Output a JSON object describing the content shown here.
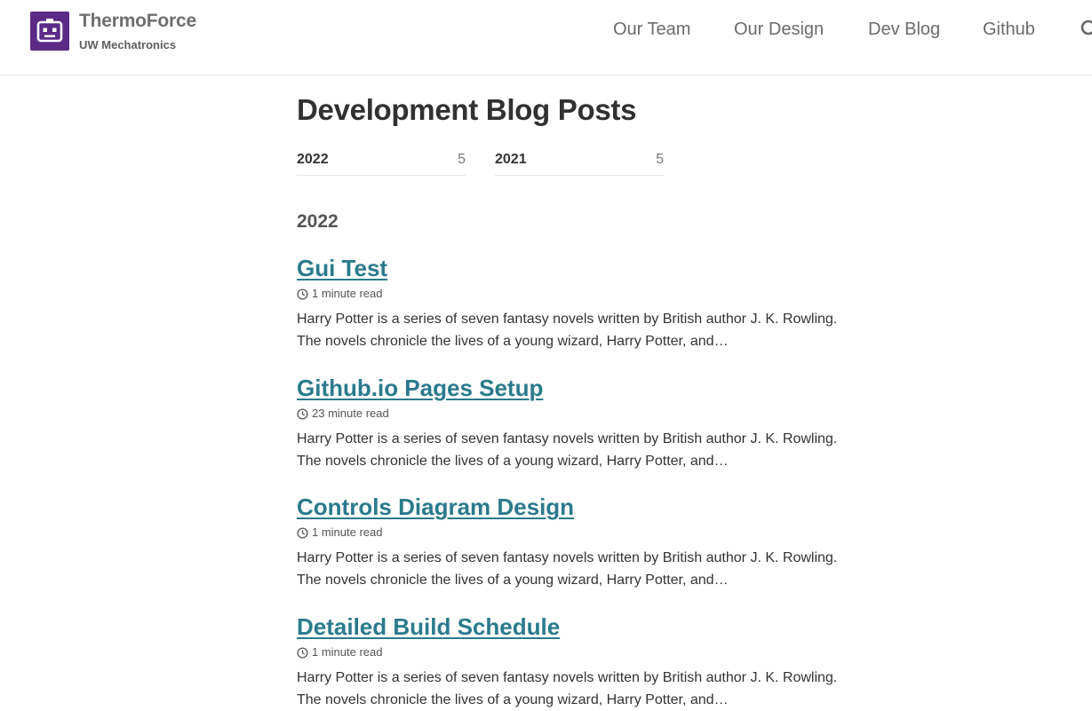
{
  "header": {
    "site_title": "ThermoForce",
    "site_subtitle": "UW Mechatronics",
    "nav": [
      "Our Team",
      "Our Design",
      "Dev Blog",
      "Github"
    ],
    "brand_color": "#5b2a86"
  },
  "main": {
    "page_title": "Development Blog Posts",
    "year_tabs": [
      {
        "year": "2022",
        "count": "5"
      },
      {
        "year": "2021",
        "count": "5"
      }
    ],
    "year_heading": "2022",
    "link_color": "#2a7a8c",
    "posts": [
      {
        "title": "Gui Test",
        "read_time": "1 minute read",
        "excerpt_line1": "Harry Potter is a series of seven fantasy novels written by British author J. K. Rowling.",
        "excerpt_line2": "The novels chronicle the lives of a young wizard, Harry Potter, and…"
      },
      {
        "title": "Github.io Pages Setup",
        "read_time": "23 minute read",
        "excerpt_line1": "Harry Potter is a series of seven fantasy novels written by British author J. K. Rowling.",
        "excerpt_line2": "The novels chronicle the lives of a young wizard, Harry Potter, and…"
      },
      {
        "title": "Controls Diagram Design",
        "read_time": "1 minute read",
        "excerpt_line1": "Harry Potter is a series of seven fantasy novels written by British author J. K. Rowling.",
        "excerpt_line2": "The novels chronicle the lives of a young wizard, Harry Potter, and…"
      },
      {
        "title": "Detailed Build Schedule",
        "read_time": "1 minute read",
        "excerpt_line1": "Harry Potter is a series of seven fantasy novels written by British author J. K. Rowling.",
        "excerpt_line2": "The novels chronicle the lives of a young wizard, Harry Potter, and…"
      }
    ]
  },
  "icons": {
    "logo": "robot-logo-icon",
    "search": "search-icon",
    "clock": "clock-icon"
  }
}
